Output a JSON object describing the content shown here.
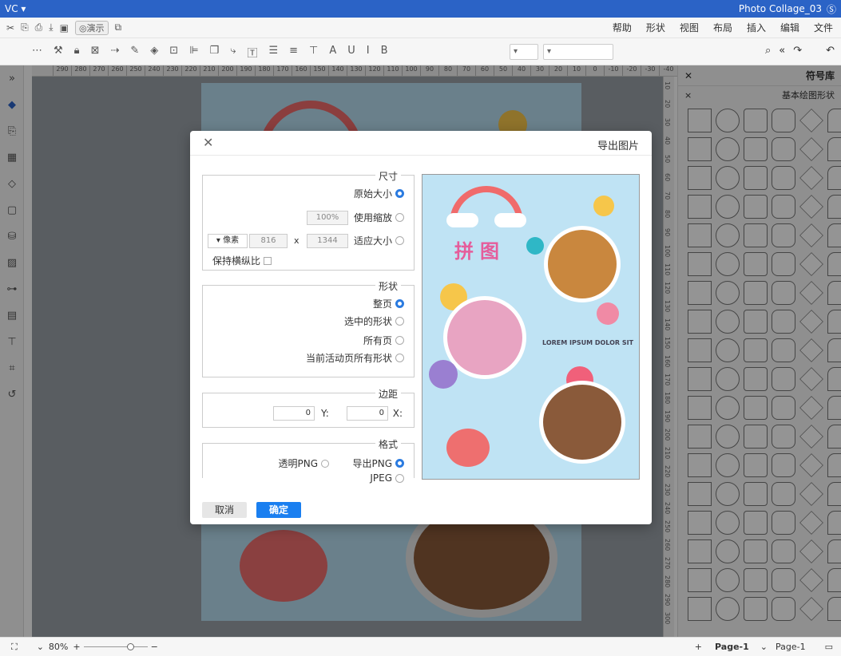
{
  "window": {
    "title": "Photo Collage_03",
    "user": "VC"
  },
  "menu": {
    "items": [
      "文件",
      "编辑",
      "插入",
      "布局",
      "视图",
      "形状",
      "帮助"
    ],
    "present": "演示"
  },
  "toolbar": {
    "font_select": "",
    "size_select": ""
  },
  "ruler": {
    "h": [
      "290",
      "280",
      "270",
      "260",
      "250",
      "240",
      "230",
      "220",
      "210",
      "200",
      "190",
      "180",
      "170",
      "160",
      "150",
      "140",
      "130",
      "120",
      "110",
      "100",
      "90",
      "80",
      "70",
      "60",
      "50",
      "40",
      "30",
      "20",
      "10",
      "0",
      "-10",
      "-20",
      "-30",
      "-40"
    ],
    "v": [
      "10",
      "20",
      "30",
      "40",
      "50",
      "60",
      "70",
      "80",
      "90",
      "100",
      "110",
      "120",
      "130",
      "140",
      "150",
      "160",
      "170",
      "180",
      "190",
      "200",
      "210",
      "220",
      "230",
      "240",
      "250",
      "260",
      "270",
      "280",
      "290",
      "300"
    ]
  },
  "sidebar": {
    "header": "符号库",
    "category": "基本绘图形状"
  },
  "status": {
    "zoom": "80%",
    "page_tab": "Page-1",
    "page_select": "Page-1"
  },
  "dialog": {
    "title": "导出图片",
    "size": {
      "legend": "尺寸",
      "original": "原始大小",
      "use_scale": "使用缩放",
      "scale_value": "100%",
      "fit": "适应大小",
      "width": "1344",
      "height": "816",
      "x": "x",
      "unit": "像素",
      "keep_ratio": "保持横纵比"
    },
    "shape": {
      "legend": "形状",
      "whole": "整页",
      "selected": "选中的形状",
      "all": "所有页",
      "current": "当前活动页所有形状"
    },
    "margin": {
      "legend": "边距",
      "x_label": "X:",
      "y_label": "Y:",
      "x": "0",
      "y": "0"
    },
    "format": {
      "legend": "格式",
      "png": "导出PNG",
      "transparent": "透明PNG",
      "jpeg": "JPEG"
    },
    "ok": "确定",
    "cancel": "取消"
  },
  "preview": {
    "title": "拼图",
    "caption": "LOREM IPSUM DOLOR SIT"
  }
}
